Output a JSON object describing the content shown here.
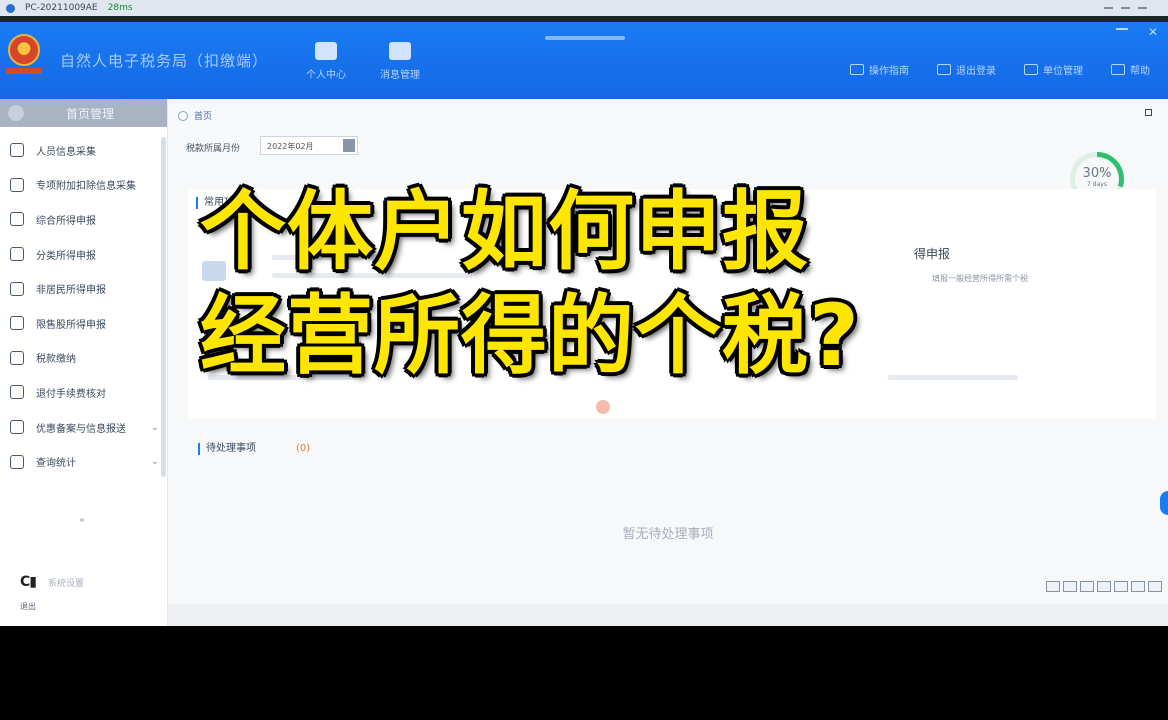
{
  "remote": {
    "host": "PC-20211009AE",
    "signal": "28ms"
  },
  "app": {
    "title": "自然人电子税务局（扣缴端）"
  },
  "top_nav": [
    {
      "label": "个人中心",
      "icon": "person-card-icon"
    },
    {
      "label": "消息管理",
      "icon": "message-icon"
    }
  ],
  "top_right": [
    {
      "label": "操作指南",
      "icon": "guide-icon"
    },
    {
      "label": "退出登录",
      "icon": "logout-icon"
    },
    {
      "label": "单位管理",
      "icon": "company-icon"
    },
    {
      "label": "帮助",
      "icon": "help-icon"
    }
  ],
  "sidebar": {
    "header": "首页管理",
    "items": [
      {
        "label": "人员信息采集",
        "icon": "person-icon",
        "has_chevron": false
      },
      {
        "label": "专项附加扣除信息采集",
        "icon": "list-icon",
        "has_chevron": false
      },
      {
        "label": "综合所得申报",
        "icon": "database-icon",
        "has_chevron": false
      },
      {
        "label": "分类所得申报",
        "icon": "clock-icon",
        "has_chevron": false
      },
      {
        "label": "非居民所得申报",
        "icon": "user-icon",
        "has_chevron": false
      },
      {
        "label": "限售股所得申报",
        "icon": "bar-chart-icon",
        "has_chevron": false
      },
      {
        "label": "税款缴纳",
        "icon": "folder-icon",
        "has_chevron": false
      },
      {
        "label": "退付手续费核对",
        "icon": "document-icon",
        "has_chevron": false
      },
      {
        "label": "优惠备案与信息报送",
        "icon": "report-icon",
        "has_chevron": true
      },
      {
        "label": "查询统计",
        "icon": "search-chart-icon",
        "has_chevron": true
      }
    ],
    "footer": "系统设置",
    "footer2": "退出"
  },
  "main": {
    "breadcrumb": "首页",
    "period_label": "税款所属月份",
    "period_value": "2022年02月",
    "progress": {
      "value": 30,
      "percent_text": "30%",
      "sub": "7 days"
    },
    "section_title": "常用功能",
    "tile_right_title": "得申报",
    "tile_right_sub": "填报一般经营所得所需个税",
    "pending_title": "待处理事项",
    "pending_count": "(0)",
    "empty_message": "暂无待处理事项"
  },
  "caption": {
    "line1": "个体户如何申报",
    "line2": "经营所得的个税?",
    "color": "#ffe600"
  },
  "colors": {
    "header_blue": "#1a7cf2",
    "sidebar_head": "#a8b4c4",
    "accent": "#1a7cf2"
  }
}
